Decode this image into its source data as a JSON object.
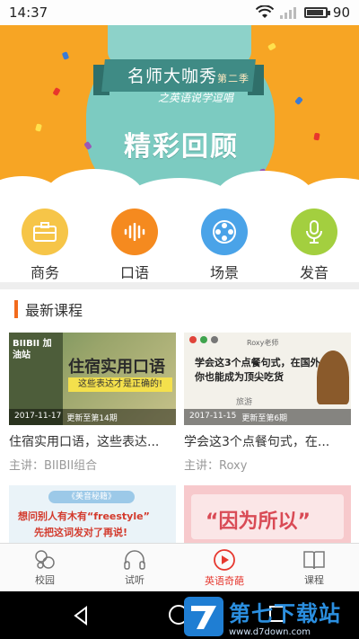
{
  "status_bar": {
    "time": "14:37",
    "battery": "90",
    "battery_level": 0.9
  },
  "banner": {
    "title": "名师大咖秀",
    "season": "第二季",
    "subtitle": "之英语说学逗唱",
    "main_text": "精彩回顾"
  },
  "categories": [
    {
      "label": "商务",
      "icon": "briefcase-icon",
      "color": "#f6c548"
    },
    {
      "label": "口语",
      "icon": "voice-wave-icon",
      "color": "#f58a1f"
    },
    {
      "label": "场景",
      "icon": "film-reel-icon",
      "color": "#4aa3e8"
    },
    {
      "label": "发音",
      "icon": "microphone-icon",
      "color": "#a3cf3f"
    }
  ],
  "section": {
    "title": "最新课程"
  },
  "courses": [
    {
      "thumb_tag": "BIIBII 加油站",
      "thumb_headline": "住宿实用口语",
      "thumb_tagline": "这些表达才是正确的!",
      "date": "2017-11-17",
      "update": "更新至第14期",
      "title": "住宿实用口语，这些表达...",
      "speaker": "主讲：BIIBII组合"
    },
    {
      "thumb_tag": "Roxy老师",
      "thumb_headline": "学会这3个点餐句式，在国外你也能成为顶尖吃货",
      "thumb_tagline": "旅游",
      "date": "2017-11-15",
      "update": "更新至第6期",
      "title": "学会这3个点餐句式，在...",
      "speaker": "主讲：Roxy"
    },
    {
      "thumb_tag": "《美音秘籍》",
      "thumb_headline": "想问别人有木有“freestyle”",
      "thumb_tagline": "先把这词发对了再说!"
    },
    {
      "thumb_tag": "",
      "thumb_headline": "“因为所以”"
    }
  ],
  "bottom_nav": [
    {
      "label": "校园",
      "icon": "campus-icon"
    },
    {
      "label": "试听",
      "icon": "headphones-icon"
    },
    {
      "label": "英语奇葩",
      "icon": "play-circle-icon",
      "active": true
    },
    {
      "label": "课程",
      "icon": "book-icon"
    }
  ],
  "watermark": {
    "title": "第七下载站",
    "url": "www.d7down.com"
  },
  "colors": {
    "accent": "#e6382f",
    "banner_bg": "#f7a524",
    "section_bar": "#f26b1d"
  }
}
